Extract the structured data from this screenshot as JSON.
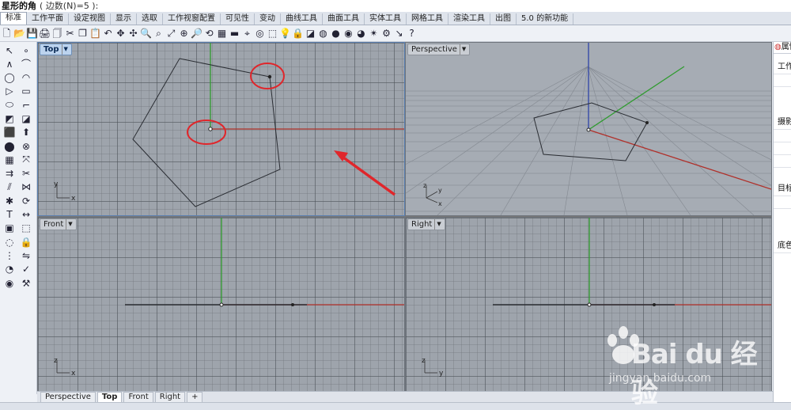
{
  "command_line": {
    "prompt": "星形的角",
    "options": "( 边数(N)=5 ):"
  },
  "menu_tabs": [
    {
      "label": "标准",
      "active": true
    },
    {
      "label": "工作平面",
      "active": false
    },
    {
      "label": "设定视图",
      "active": false
    },
    {
      "label": "显示",
      "active": false
    },
    {
      "label": "选取",
      "active": false
    },
    {
      "label": "工作视窗配置",
      "active": false
    },
    {
      "label": "可见性",
      "active": false
    },
    {
      "label": "变动",
      "active": false
    },
    {
      "label": "曲线工具",
      "active": false
    },
    {
      "label": "曲面工具",
      "active": false
    },
    {
      "label": "实体工具",
      "active": false
    },
    {
      "label": "网格工具",
      "active": false
    },
    {
      "label": "渲染工具",
      "active": false
    },
    {
      "label": "出图",
      "active": false
    },
    {
      "label": "5.0 的新功能",
      "active": false
    }
  ],
  "toolbar_icons": [
    {
      "name": "new-file-icon",
      "glyph": "🗋"
    },
    {
      "name": "open-file-icon",
      "glyph": "📂"
    },
    {
      "name": "save-icon",
      "glyph": "💾"
    },
    {
      "name": "print-icon",
      "glyph": "🖨"
    },
    {
      "name": "import-icon",
      "glyph": "🗍"
    },
    {
      "name": "cut-icon",
      "glyph": "✂"
    },
    {
      "name": "copy-icon",
      "glyph": "❐"
    },
    {
      "name": "paste-icon",
      "glyph": "📋"
    },
    {
      "name": "undo-icon",
      "glyph": "↶"
    },
    {
      "name": "pan-icon",
      "glyph": "✥"
    },
    {
      "name": "rotate-view-icon",
      "glyph": "✣"
    },
    {
      "name": "zoom-icon",
      "glyph": "🔍"
    },
    {
      "name": "zoom-window-icon",
      "glyph": "⌕"
    },
    {
      "name": "zoom-extents-icon",
      "glyph": "⤢"
    },
    {
      "name": "zoom-selected-icon",
      "glyph": "⊕"
    },
    {
      "name": "zoom-target-icon",
      "glyph": "🔎"
    },
    {
      "name": "named-view-icon",
      "glyph": "⟲"
    },
    {
      "name": "four-viewports-icon",
      "glyph": "▦"
    },
    {
      "name": "cplane-icon",
      "glyph": "▬"
    },
    {
      "name": "grid-snap-icon",
      "glyph": "⌖"
    },
    {
      "name": "osnap-icon",
      "glyph": "◎"
    },
    {
      "name": "select-icon",
      "glyph": "⬚"
    },
    {
      "name": "light-icon",
      "glyph": "💡"
    },
    {
      "name": "lock-icon",
      "glyph": "🔒"
    },
    {
      "name": "layer-icon",
      "glyph": "◪"
    },
    {
      "name": "color-wheel-icon",
      "glyph": "◍"
    },
    {
      "name": "shaded-sphere-icon",
      "glyph": "●"
    },
    {
      "name": "render-sphere-icon",
      "glyph": "◉"
    },
    {
      "name": "material-sphere-icon",
      "glyph": "◕"
    },
    {
      "name": "render-icon",
      "glyph": "✴"
    },
    {
      "name": "options-icon",
      "glyph": "⚙"
    },
    {
      "name": "dimension-icon",
      "glyph": "↘"
    },
    {
      "name": "help-icon",
      "glyph": "?"
    }
  ],
  "sidebar_icons": [
    "select-arrow-icon",
    "point-icon",
    "polyline-icon",
    "curve-icon",
    "circle-icon",
    "arc-icon",
    "triangle-icon",
    "rectangle-icon",
    "ellipse-icon",
    "fillet-icon",
    "surface-plane-icon",
    "surface-edge-icon",
    "box-icon",
    "extrude-icon",
    "cylinder-icon",
    "boolean-icon",
    "mesh-icon",
    "transform-icon",
    "offset-icon",
    "trim-icon",
    "split-icon",
    "join-icon",
    "explode-icon",
    "rebuild-icon",
    "text-icon",
    "dimension-icon",
    "group-icon",
    "block-icon",
    "hide-icon",
    "lock-obj-icon",
    "array-icon",
    "mirror-icon",
    "analyze-icon",
    "check-icon",
    "render-obj-icon",
    "wrench-icon"
  ],
  "viewports": {
    "top": {
      "title": "Top",
      "active": true,
      "axis_labels": [
        "y",
        "x"
      ]
    },
    "perspective": {
      "title": "Perspective",
      "active": false,
      "axis_labels": [
        "z",
        "y",
        "x"
      ]
    },
    "front": {
      "title": "Front",
      "active": false,
      "axis_labels": [
        "z",
        "x"
      ]
    },
    "right": {
      "title": "Right",
      "active": false,
      "axis_labels": [
        "z",
        "y"
      ]
    }
  },
  "bottom_tabs": [
    {
      "label": "Perspective",
      "active": false
    },
    {
      "label": "Top",
      "active": true
    },
    {
      "label": "Front",
      "active": false
    },
    {
      "label": "Right",
      "active": false
    },
    {
      "label": "+",
      "active": false
    }
  ],
  "right_panel": {
    "header": "属性",
    "labels": [
      "工作",
      "摄影",
      "目标",
      "底色"
    ]
  },
  "watermark": {
    "brand": "Bai  du 经验",
    "url": "jingyan.baidu.com"
  },
  "colors": {
    "x_axis": "#b0302a",
    "y_axis": "#2f9b2f",
    "z_axis": "#2f44a8",
    "highlight": "#e0262b",
    "curve": "#2a2d33"
  }
}
